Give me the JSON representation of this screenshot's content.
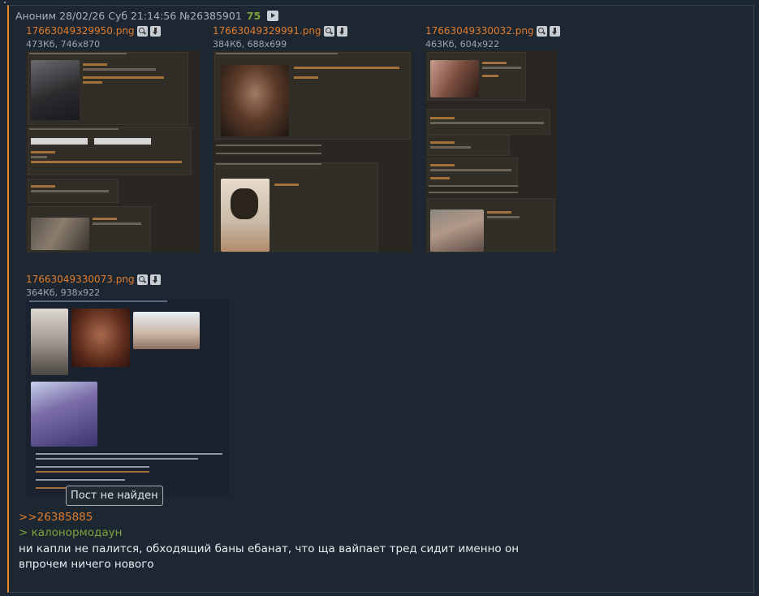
{
  "post": {
    "author": "Аноним",
    "date": "28/02/26 Суб 21:14:56",
    "number": "№26385901",
    "reply_count": "75"
  },
  "files": [
    {
      "name": "17663049329950.png",
      "meta": "473Кб, 746x870"
    },
    {
      "name": "17663049329991.png",
      "meta": "384Кб, 688x699"
    },
    {
      "name": "17663049330032.png",
      "meta": "463Кб, 604x922"
    },
    {
      "name": "17663049330073.png",
      "meta": "364Кб, 938x922"
    }
  ],
  "tooltip": "Пост не найден",
  "reply_link": ">>26385885",
  "greentext": "> калонормодаун",
  "message_lines": [
    "ни капли не палится, обходящий баны ебанат, что ща вайпает тред сидит именно он",
    "впрочем ничего нового"
  ],
  "icons": [
    "search-icon",
    "download-icon",
    "play-icon"
  ]
}
